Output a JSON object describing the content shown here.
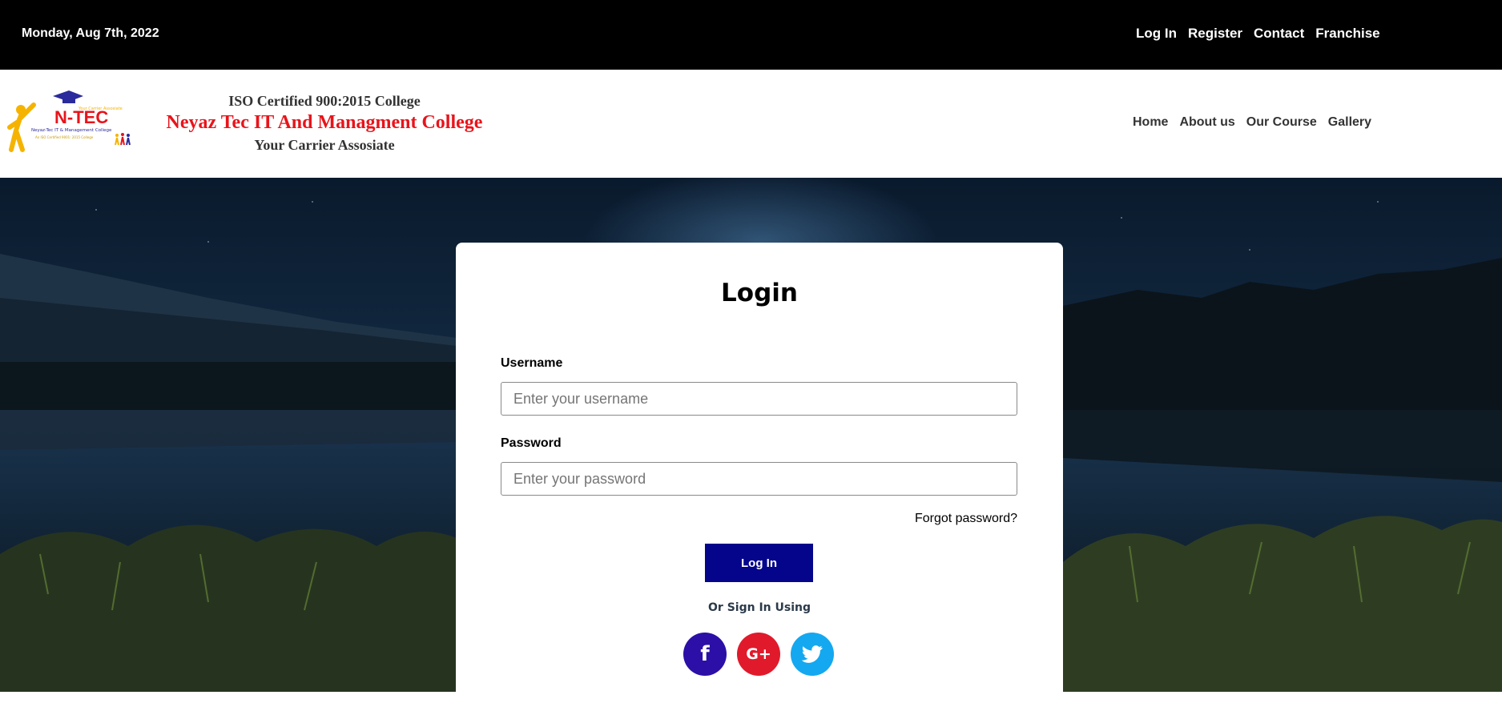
{
  "topbar": {
    "date": "Monday, Aug 7th, 2022",
    "links": [
      "Log In",
      "Register",
      "Contact",
      "Franchise"
    ]
  },
  "header": {
    "logo_text": "N-TEC",
    "iso": "ISO Certified 900:2015 College",
    "college_name": "Neyaz Tec IT And Managment College",
    "tagline": "Your Carrier Assosiate",
    "nav": [
      "Home",
      "About us",
      "Our Course",
      "Gallery"
    ]
  },
  "login": {
    "title": "Login",
    "username_label": "Username",
    "username_placeholder": "Enter your username",
    "password_label": "Password",
    "password_placeholder": "Enter your password",
    "forgot": "Forgot password?",
    "submit": "Log In",
    "or_text": "Or Sign In Using",
    "social": [
      {
        "icon": "facebook-icon",
        "glyph": "f",
        "color": "#2c0fa6"
      },
      {
        "icon": "google-plus-icon",
        "glyph": "G+",
        "color": "#e01a2b"
      },
      {
        "icon": "twitter-icon",
        "glyph": "",
        "color": "#14a8f0"
      }
    ]
  },
  "colors": {
    "topbar_bg": "#000000",
    "brand_red": "#e8141b",
    "button_blue": "#05058c"
  }
}
